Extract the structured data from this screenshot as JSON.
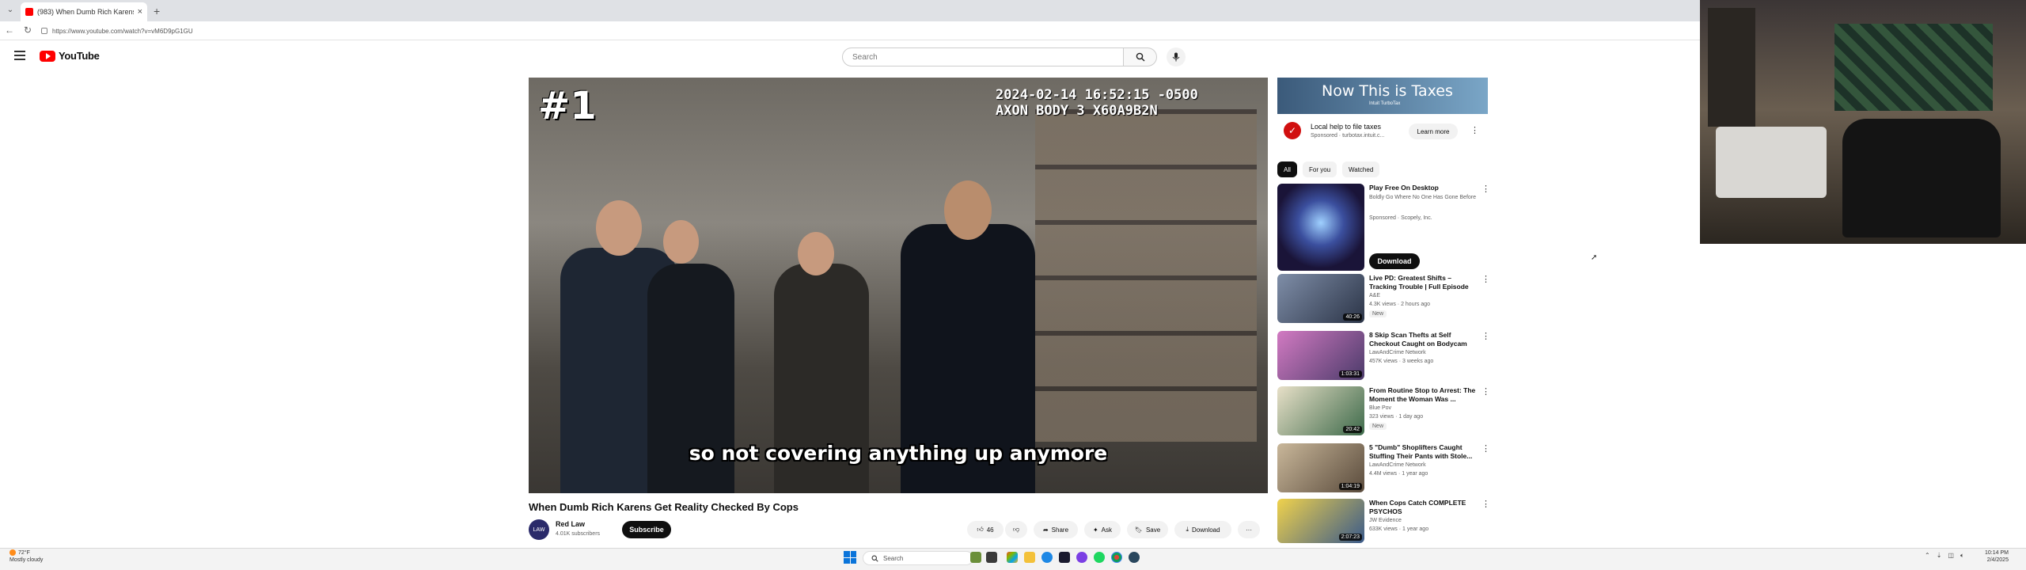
{
  "browser": {
    "tab_title": "(983) When Dumb Rich Karens",
    "tab_close": "×",
    "new_tab": "+",
    "url": "https://www.youtube.com/watch?v=vM6D9pG1GU",
    "back": "←",
    "reload": "↻"
  },
  "youtube": {
    "logo_text": "YouTube",
    "search_placeholder": "Search"
  },
  "video": {
    "rank_overlay": "#1",
    "timestamp_line1": "2024-02-14 16:52:15 -0500",
    "timestamp_line2": "AXON BODY 3 X60A9B2N",
    "caption": "so not covering anything up anymore",
    "title": "When Dumb Rich Karens Get Reality Checked By Cops",
    "channel_name": "Red Law",
    "channel_avatar_text": "LAW",
    "channel_subs": "4.01K subscribers",
    "subscribe_label": "Subscribe",
    "like_count": "46",
    "share_label": "Share",
    "ask_label": "Ask",
    "save_label": "Save",
    "download_label": "Download",
    "more_label": "···"
  },
  "ad": {
    "banner_text": "Now This is Taxes",
    "banner_small": "Intuit TurboTax",
    "title": "Local help to file taxes",
    "meta": "Sponsored · turbotax.intuit.c...",
    "learn_more": "Learn more",
    "more": "⋮"
  },
  "chips": [
    "All",
    "For you",
    "Watched"
  ],
  "recommendations": [
    {
      "title": "Play Free On Desktop",
      "channel": "Boldly Go Where No One Has Gone Before",
      "meta": "Sponsored · Scopely, Inc.",
      "badge": "",
      "duration": "",
      "cta": "Download"
    },
    {
      "title": "Live PD: Greatest Shifts – Tracking Trouble | Full Episode",
      "channel": "A&E",
      "meta": "4.3K views · 2 hours ago",
      "badge": "New",
      "duration": "40:26",
      "cta": ""
    },
    {
      "title": "8 Skip Scan Thefts at Self Checkout Caught on Bodycam",
      "channel": "LawAndCrime Network",
      "meta": "457K views · 3 weeks ago",
      "badge": "",
      "duration": "1:03:31",
      "cta": ""
    },
    {
      "title": "From Routine Stop to Arrest: The Moment the Woman Was ...",
      "channel": "Blue Pov",
      "meta": "323 views · 1 day ago",
      "badge": "New",
      "duration": "20:42",
      "cta": ""
    },
    {
      "title": "5 \"Dumb\" Shoplifters Caught Stuffing Their Pants with Stole...",
      "channel": "LawAndCrime Network",
      "meta": "4.4M views · 1 year ago",
      "badge": "",
      "duration": "1:04:19",
      "cta": ""
    },
    {
      "title": "When Cops Catch COMPLETE PSYCHOS",
      "channel": "JW Evidence",
      "meta": "633K views · 1 year ago",
      "badge": "",
      "duration": "2:07:23",
      "cta": ""
    }
  ],
  "taskbar": {
    "weather_temp": "72°F",
    "weather_desc": "Mostly cloudy",
    "search_label": "Search",
    "time": "10:14 PM",
    "date": "2/4/2025"
  },
  "colors": {
    "youtube_red": "#ff0000",
    "accent_black": "#0f0f0f",
    "windows_blue": "#0a74da"
  }
}
